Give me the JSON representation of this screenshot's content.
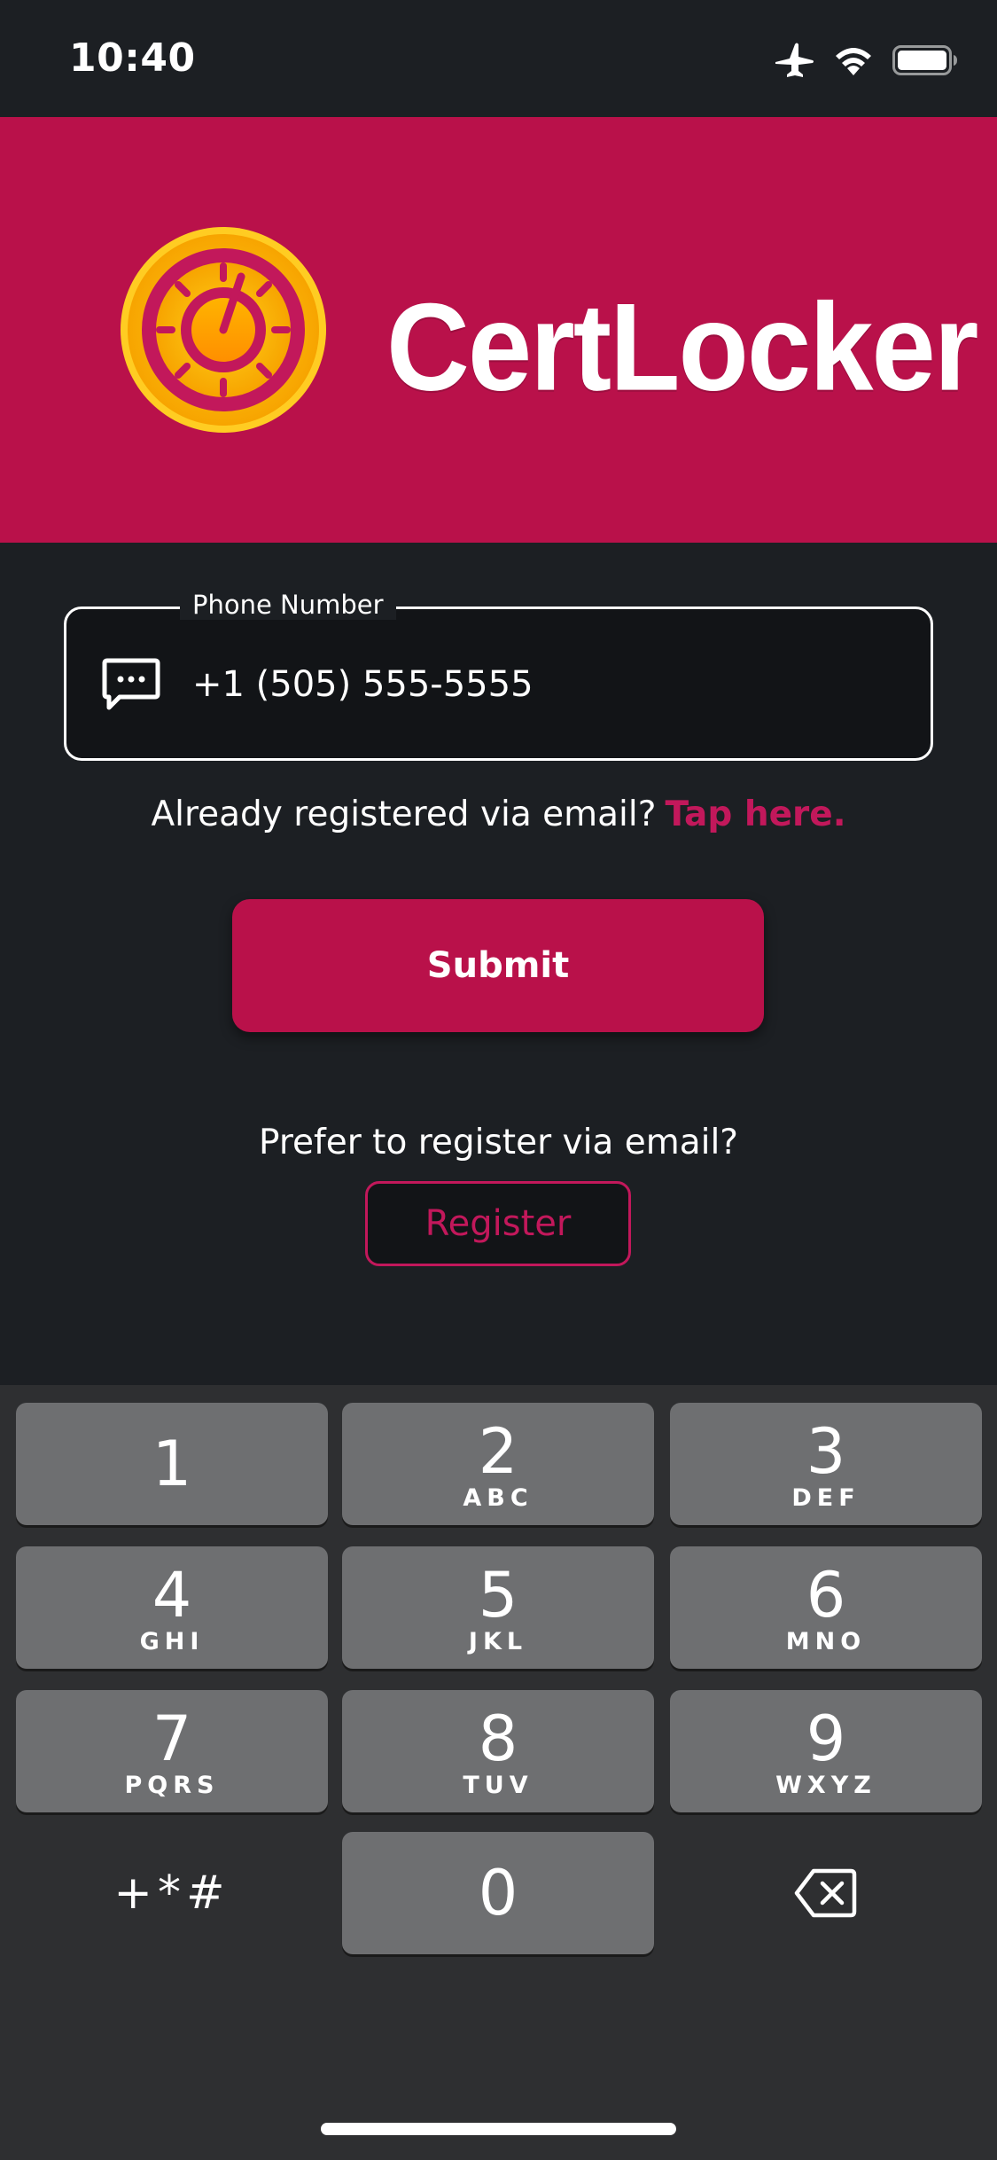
{
  "status_bar": {
    "time": "10:40",
    "icons": [
      "airplane-icon",
      "wifi-icon",
      "battery-icon"
    ]
  },
  "banner": {
    "brand_name": "CertLocker",
    "logo_icon": "gauge-badge-icon",
    "background_color": "#b9114a"
  },
  "phone_field": {
    "label": "Phone Number",
    "value": "+1 (505) 555-5555",
    "icon": "message-icon"
  },
  "already_registered": {
    "prompt": "Already registered via email?",
    "link_label": "Tap here."
  },
  "submit": {
    "label": "Submit"
  },
  "email_register": {
    "prompt": "Prefer to register via email?",
    "button_label": "Register"
  },
  "keypad": {
    "keys": [
      {
        "digit": "1",
        "letters": ""
      },
      {
        "digit": "2",
        "letters": "ABC"
      },
      {
        "digit": "3",
        "letters": "DEF"
      },
      {
        "digit": "4",
        "letters": "GHI"
      },
      {
        "digit": "5",
        "letters": "JKL"
      },
      {
        "digit": "6",
        "letters": "MNO"
      },
      {
        "digit": "7",
        "letters": "PQRS"
      },
      {
        "digit": "8",
        "letters": "TUV"
      },
      {
        "digit": "9",
        "letters": "WXYZ"
      },
      {
        "digit": "0",
        "letters": ""
      }
    ],
    "symbols_label": "+*#",
    "delete_icon": "backspace-icon"
  },
  "colors": {
    "accent": "#c2185b",
    "background": "#1c1f23",
    "keypad_bg": "#2e2f31",
    "key_bg": "#6e6f71"
  }
}
